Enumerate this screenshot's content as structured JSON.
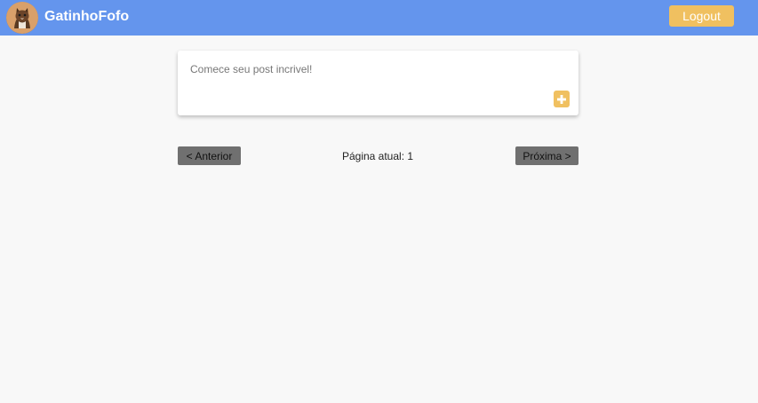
{
  "header": {
    "brand": "GatinhoFofo",
    "logout_label": "Logout",
    "bg_color": "#6495ed",
    "accent_color": "#f0c060"
  },
  "composer": {
    "placeholder": "Comece seu post incrivel!",
    "add_icon": "plus-icon"
  },
  "pagination": {
    "prev_label": "< Anterior",
    "next_label": "Próxima >",
    "current_page_label": "Página atual: 1"
  }
}
